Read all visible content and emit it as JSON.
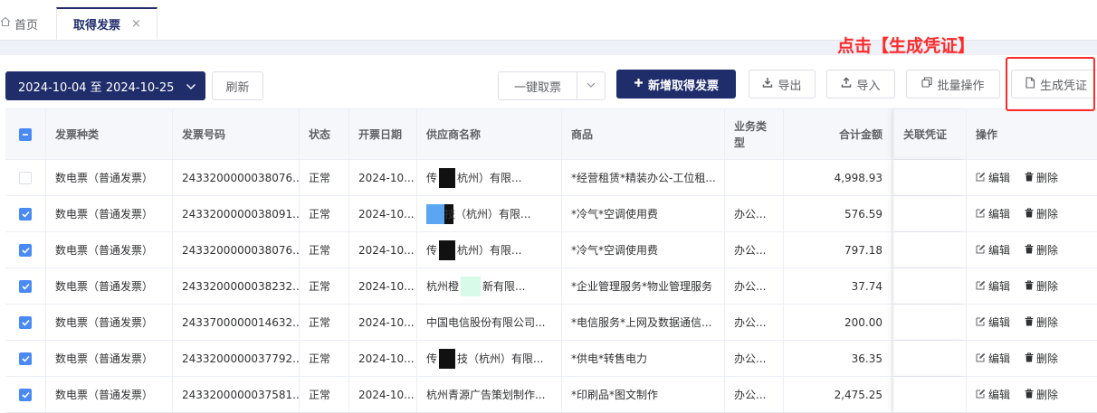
{
  "tabs": {
    "home_label": "首页",
    "active_label": "取得发票",
    "close_glyph": "×"
  },
  "annotation": "点击【生成凭证】",
  "toolbar": {
    "date_range": "2024-10-04 至 2024-10-25",
    "refresh": "刷新",
    "fetch": "一键取票",
    "add": "新增取得发票",
    "export": "导出",
    "import": "导入",
    "batch": "批量操作",
    "generate": "生成凭证"
  },
  "table": {
    "headers": {
      "type": "发票种类",
      "number": "发票号码",
      "status": "状态",
      "date": "开票日期",
      "supplier": "供应商名称",
      "goods": "商品",
      "biz_line1": "业务类",
      "biz_line2": "型",
      "amount": "合计金额",
      "voucher": "关联凭证",
      "ops": "操作"
    },
    "op_edit": "编辑",
    "op_delete": "删除",
    "rows": [
      {
        "checked": false,
        "type": "数电票（普通发票）",
        "number": "2433200000038076...",
        "status": "正常",
        "date": "2024-10...",
        "sup_pre": "传",
        "sup_post": "杭州）有限...",
        "mask": "black",
        "goods": "*经营租赁*精装办公-工位租...",
        "biz": "",
        "amount": "4,998.93",
        "voucher": ""
      },
      {
        "checked": true,
        "type": "数电票（普通发票）",
        "number": "2433200000038091...",
        "status": "正常",
        "date": "2024-10...",
        "sup_pre": "",
        "sup_post": "技（杭州）有限...",
        "mask": "blue",
        "goods": "*冷气*空调使用费",
        "biz": "办公...",
        "amount": "576.59",
        "voucher": ""
      },
      {
        "checked": true,
        "type": "数电票（普通发票）",
        "number": "2433200000038076...",
        "status": "正常",
        "date": "2024-10...",
        "sup_pre": "传",
        "sup_post": "杭州）有限...",
        "mask": "black",
        "goods": "*冷气*空调使用费",
        "biz": "办公...",
        "amount": "797.18",
        "voucher": ""
      },
      {
        "checked": true,
        "type": "数电票（普通发票）",
        "number": "2433200000038232...",
        "status": "正常",
        "date": "2024-10...",
        "sup_pre": "杭州橙",
        "sup_post": "新有限...",
        "mask": "mint",
        "goods": "*企业管理服务*物业管理服务",
        "biz": "办公...",
        "amount": "37.74",
        "voucher": ""
      },
      {
        "checked": true,
        "type": "数电票（普通发票）",
        "number": "2433700000014632...",
        "status": "正常",
        "date": "2024-10...",
        "sup_pre": "中国电信股份有限公司...",
        "sup_post": "",
        "mask": "none",
        "goods": "*电信服务*上网及数据通信...",
        "biz": "办公...",
        "amount": "200.00",
        "voucher": ""
      },
      {
        "checked": true,
        "type": "数电票（普通发票）",
        "number": "2433200000037792...",
        "status": "正常",
        "date": "2024-10...",
        "sup_pre": "传",
        "sup_post": "技（杭州）有限...",
        "mask": "black",
        "goods": "*供电*转售电力",
        "biz": "办公...",
        "amount": "36.35",
        "voucher": ""
      },
      {
        "checked": true,
        "type": "数电票（普通发票）",
        "number": "2433200000037581...",
        "status": "正常",
        "date": "2024-10...",
        "sup_pre": "杭州青源广告策划制作...",
        "sup_post": "",
        "mask": "none",
        "goods": "*印刷品*图文制作",
        "biz": "办公...",
        "amount": "2,475.25",
        "voucher": ""
      }
    ]
  }
}
